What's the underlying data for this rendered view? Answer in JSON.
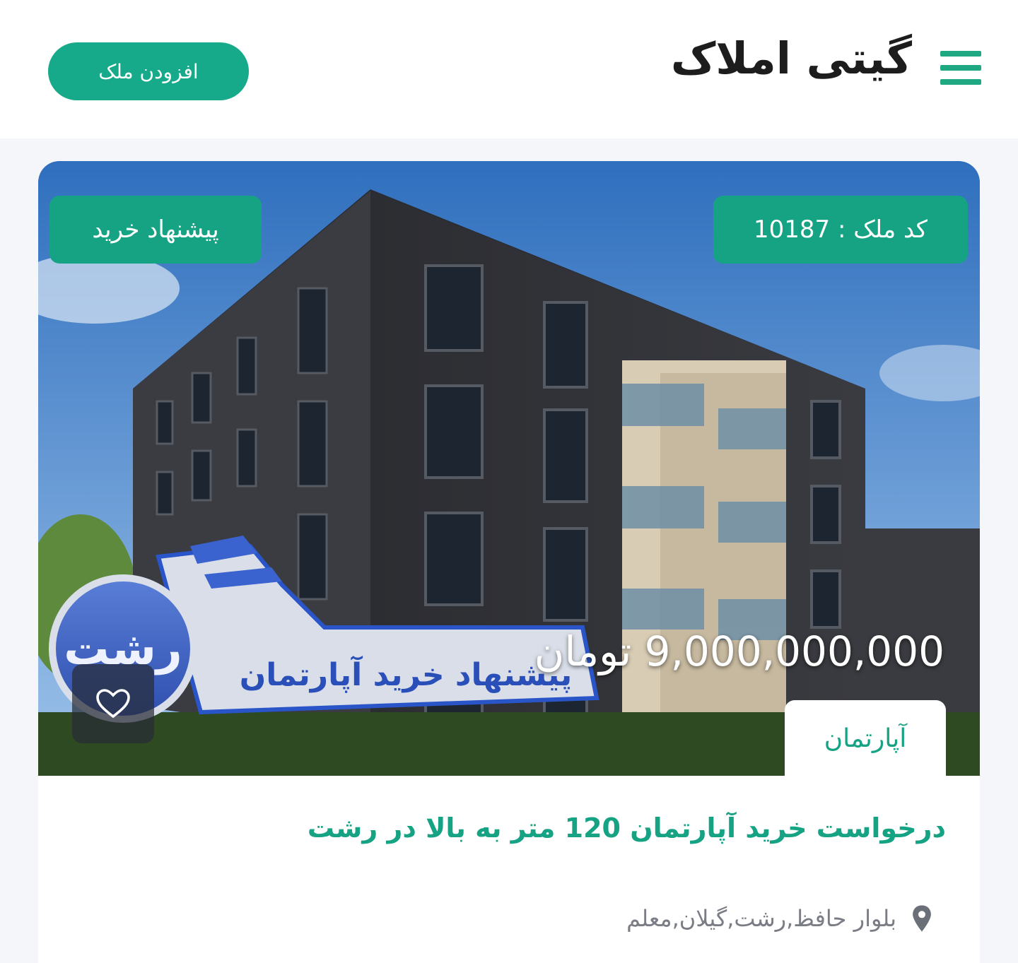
{
  "header": {
    "brand": "گیتی املاک",
    "add_property_label": "افزودن ملک",
    "menu_icon": "hamburger-menu-icon"
  },
  "colors": {
    "accent": "#16a98a",
    "price_text": "#ffffff",
    "location_text": "#7a7d85"
  },
  "listing": {
    "property_code": "کد ملک : 10187",
    "offer_badge": "پیشنهاد خرید",
    "price": "9,000,000,000 تومان",
    "type": "آپارتمان",
    "title": "درخواست خرید آپارتمان 120 متر به بالا در رشت",
    "location": "بلوار حافظ,رشت,گیلان,معلم",
    "image_banner": {
      "city": "رشت",
      "caption": "پیشنهاد خرید آپارتمان"
    },
    "favorite_icon": "heart-icon",
    "location_icon": "map-pin-icon"
  }
}
